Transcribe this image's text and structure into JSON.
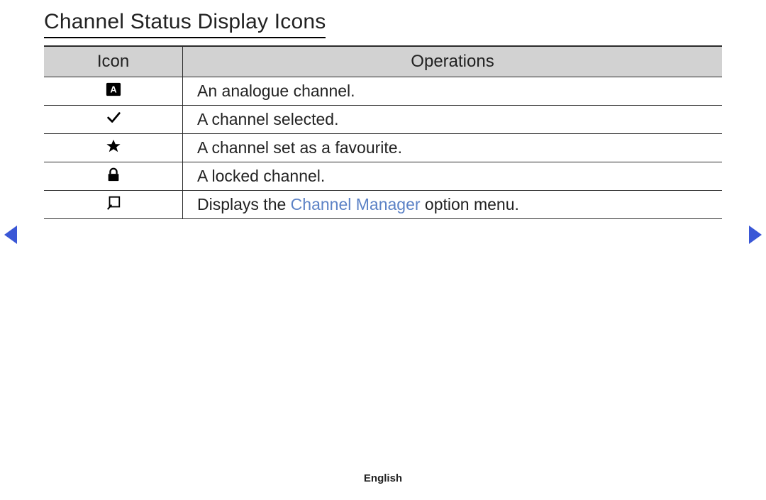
{
  "title": "Channel Status Display Icons",
  "table": {
    "headers": {
      "icon": "Icon",
      "operations": "Operations"
    },
    "rows": [
      {
        "icon_name": "analogue-a-icon",
        "operation": "An analogue channel."
      },
      {
        "icon_name": "check-icon",
        "operation": "A channel selected."
      },
      {
        "icon_name": "star-icon",
        "operation": "A channel set as a favourite."
      },
      {
        "icon_name": "lock-icon",
        "operation": "A locked channel."
      },
      {
        "icon_name": "option-menu-icon",
        "operation_prefix": "Displays the ",
        "operation_link": "Channel Manager",
        "operation_suffix": " option menu."
      }
    ]
  },
  "footer": {
    "language": "English"
  }
}
